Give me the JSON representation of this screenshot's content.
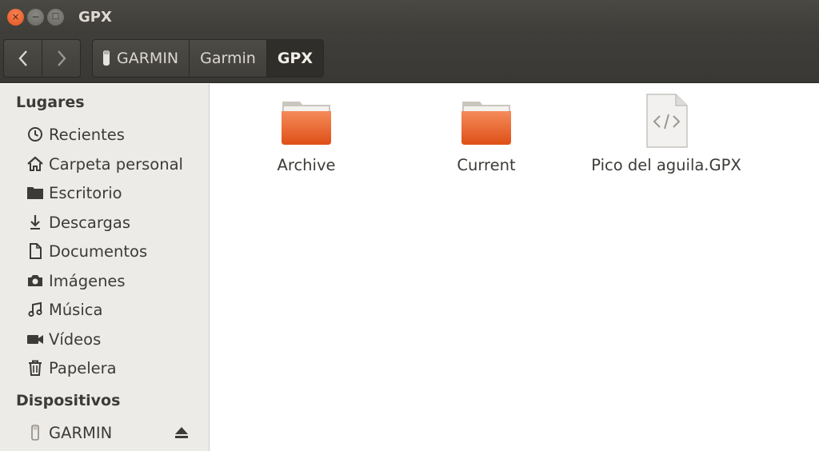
{
  "window": {
    "title": "GPX",
    "close_glyph": "×",
    "minimize_glyph": "−",
    "maximize_glyph": "□"
  },
  "toolbar": {
    "back_glyph": "‹",
    "forward_glyph": "›",
    "breadcrumbs": [
      {
        "label": "GARMIN",
        "icon": "usb-drive-icon"
      },
      {
        "label": "Garmin"
      },
      {
        "label": "GPX",
        "active": true
      }
    ]
  },
  "sidebar": {
    "places_title": "Lugares",
    "places": [
      {
        "label": "Recientes",
        "icon": "clock-icon"
      },
      {
        "label": "Carpeta personal",
        "icon": "home-icon"
      },
      {
        "label": "Escritorio",
        "icon": "folder-icon"
      },
      {
        "label": "Descargas",
        "icon": "download-icon"
      },
      {
        "label": "Documentos",
        "icon": "document-icon"
      },
      {
        "label": "Imágenes",
        "icon": "camera-icon"
      },
      {
        "label": "Música",
        "icon": "music-icon"
      },
      {
        "label": "Vídeos",
        "icon": "video-icon"
      },
      {
        "label": "Papelera",
        "icon": "trash-icon"
      }
    ],
    "devices_title": "Dispositivos",
    "devices": [
      {
        "label": "GARMIN",
        "icon": "usb-drive-icon",
        "eject_icon": "eject-icon"
      }
    ]
  },
  "files": [
    {
      "label": "Archive",
      "type": "folder",
      "icon": "folder-icon"
    },
    {
      "label": "Current",
      "type": "folder",
      "icon": "folder-icon"
    },
    {
      "label": "Pico del aguila.GPX",
      "type": "file",
      "icon": "xml-file-icon"
    }
  ],
  "colors": {
    "folder_orange": "#e9662e",
    "close_button": "#e2521b",
    "titlebar": "#3e3d39"
  }
}
